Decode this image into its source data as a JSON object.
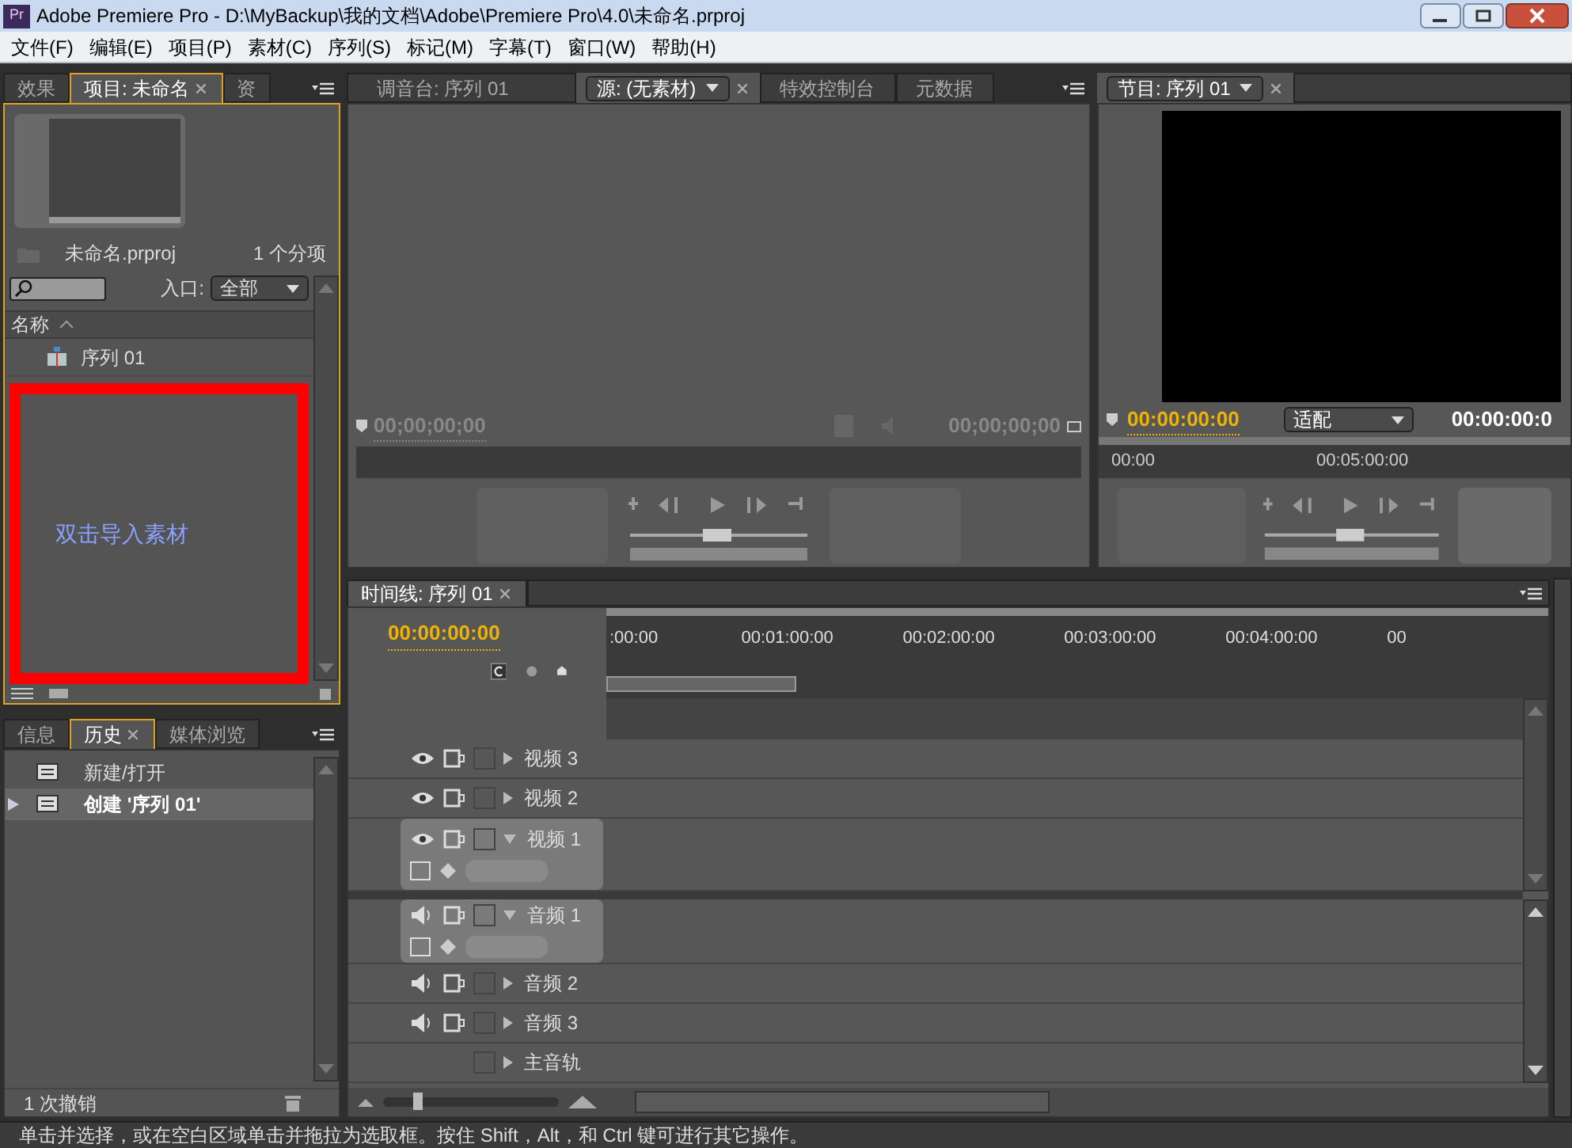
{
  "window": {
    "logo": "Pr",
    "title": "Adobe Premiere Pro - D:\\MyBackup\\我的文档\\Adobe\\Premiere Pro\\4.0\\未命名.prproj"
  },
  "menu": [
    "文件(F)",
    "编辑(E)",
    "项目(P)",
    "素材(C)",
    "序列(S)",
    "标记(M)",
    "字幕(T)",
    "窗口(W)",
    "帮助(H)"
  ],
  "project_panel": {
    "tabs": [
      {
        "label": "效果",
        "selected": false
      },
      {
        "label": "项目: 未命名",
        "selected": true
      },
      {
        "label": "资",
        "selected": false
      }
    ],
    "file_name": "未命名.prproj",
    "item_count": "1 个分项",
    "entry_label": "入口:",
    "entry_value": "全部",
    "column_header": "名称",
    "items": [
      {
        "label": "序列 01"
      }
    ],
    "annotation": "双击导入素材"
  },
  "history_panel": {
    "tabs": [
      {
        "label": "信息",
        "selected": false
      },
      {
        "label": "历史",
        "selected": true
      },
      {
        "label": "媒体浏览",
        "selected": false
      }
    ],
    "entries": [
      {
        "label": "新建/打开",
        "selected": false
      },
      {
        "label": "创建 '序列 01'",
        "selected": true
      }
    ],
    "undo_count": "1 次撤销"
  },
  "source_monitor": {
    "tabs": [
      {
        "label": "调音台: 序列 01",
        "selected": false,
        "kind": "plain"
      },
      {
        "label": "源: (无素材)",
        "selected": true,
        "kind": "dropdown"
      },
      {
        "label": "特效控制台",
        "selected": false,
        "kind": "plain"
      },
      {
        "label": "元数据",
        "selected": false,
        "kind": "plain"
      }
    ],
    "timecode": "00;00;00;00",
    "duration": "00;00;00;00"
  },
  "program_monitor": {
    "tab": "节目: 序列 01",
    "timecode": "00:00:00:00",
    "zoom": "适配",
    "duration": "00:00:00:0",
    "ruler": [
      "00:00",
      "00:05:00:00"
    ]
  },
  "timeline": {
    "tab": "时间线: 序列 01",
    "timecode": "00:00:00:00",
    "zoom_slider": {
      "level": 0.2
    },
    "ruler": [
      ":00:00",
      "00:01:00:00",
      "00:02:00:00",
      "00:03:00:00",
      "00:04:00:00",
      "00"
    ],
    "tracks": [
      {
        "kind": "video",
        "name": "视频 3",
        "expanded": false
      },
      {
        "kind": "video",
        "name": "视频 2",
        "expanded": false
      },
      {
        "kind": "video",
        "name": "视频 1",
        "expanded": true
      },
      {
        "kind": "audio",
        "name": "音频 1",
        "expanded": true
      },
      {
        "kind": "audio",
        "name": "音频 2",
        "expanded": false
      },
      {
        "kind": "audio",
        "name": "音频 3",
        "expanded": false
      },
      {
        "kind": "master",
        "name": "主音轨",
        "expanded": false
      }
    ]
  },
  "status_bar": "单击并选择，或在空白区域单击并拖拉为选取框。按住 Shift，Alt，和 Ctrl 键可进行其它操作。"
}
